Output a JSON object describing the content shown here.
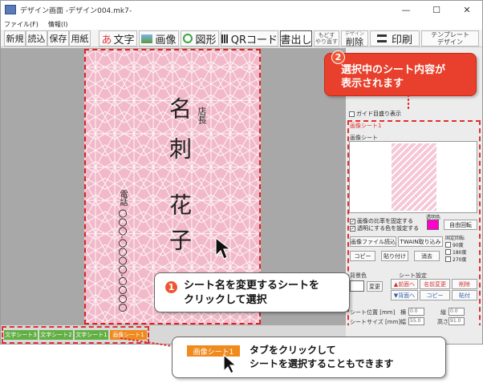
{
  "window": {
    "title": "デザイン画面 -デザイン004.mk7-",
    "menu": [
      "ファイル(F)",
      "情報(I)"
    ],
    "controls": [
      "—",
      "☐",
      "✕"
    ]
  },
  "toolbar": {
    "new": "新規",
    "open": "読込",
    "save": "保存",
    "paper": "用紙",
    "text": "文字",
    "text_prefix": "あ",
    "image": "画像",
    "shape": "図形",
    "qr": "QRコード",
    "write": "書出し",
    "undo": "もどす",
    "redo": "やり直す",
    "delete_top": "デザイン",
    "delete": "削除",
    "print": "印刷",
    "template_1": "テンプレート",
    "template_2": "デザイン"
  },
  "card": {
    "title": "店長",
    "name_1": "名",
    "name_2": "刺",
    "name_3": "花",
    "name_4": "子",
    "phone_label": "電話",
    "phone": "〇〇〇-〇〇〇〇-〇〇〇〇"
  },
  "panel": {
    "guide": "ガイド目盛り表示",
    "sheet_name": "画像シート1",
    "preview_label": "画像シート",
    "transparent_label": "透明色",
    "keep_ratio": "画像の比率を固定する",
    "transparent_check": "透明にする色を設定する",
    "free_rotate": "自由回転",
    "load_image": "画像ファイル読込",
    "twain": "TWAIN取り込み",
    "copy": "コピー",
    "paste": "貼り付け",
    "clear": "消去",
    "fixed_rotate": "固定回転",
    "rot90": "90度",
    "rot180": "180度",
    "rot270": "270度",
    "bg_color": "背景色",
    "change": "変更",
    "sheet_settings": "シート設定",
    "to_front": "前面へ",
    "rename": "名前変更",
    "del": "削除",
    "to_back": "背面へ",
    "copy2": "コピー",
    "paste2": "貼付",
    "pos_label": "シート位置 [mm]",
    "pos_x_label": "横",
    "pos_x": "0.0",
    "pos_y_label": "縦",
    "pos_y": "0.0",
    "size_label": "シートサイズ [mm]",
    "width_label": "幅",
    "width": "55.0",
    "height_label": "高さ",
    "height": "91.0"
  },
  "tabs": [
    "文字シート3",
    "文字シート2",
    "文字シート1",
    "画像シート1"
  ],
  "callouts": {
    "c1_num": "1",
    "c1_line1": "シート名を変更するシートを",
    "c1_line2": "クリックして選択",
    "c2_num": "2",
    "c2_line1": "選択中のシート内容が",
    "c2_line2": "表示されます",
    "c3_tab": "画像シート1",
    "c3_line1": "タブをクリックして",
    "c3_line2": "シートを選択することもできます"
  },
  "colors": {
    "accent": "#e53",
    "tab_green": "#62b044",
    "tab_orange": "#f08a1c",
    "card_pink": "#f4c6d2",
    "magenta": "#ff00cc"
  }
}
